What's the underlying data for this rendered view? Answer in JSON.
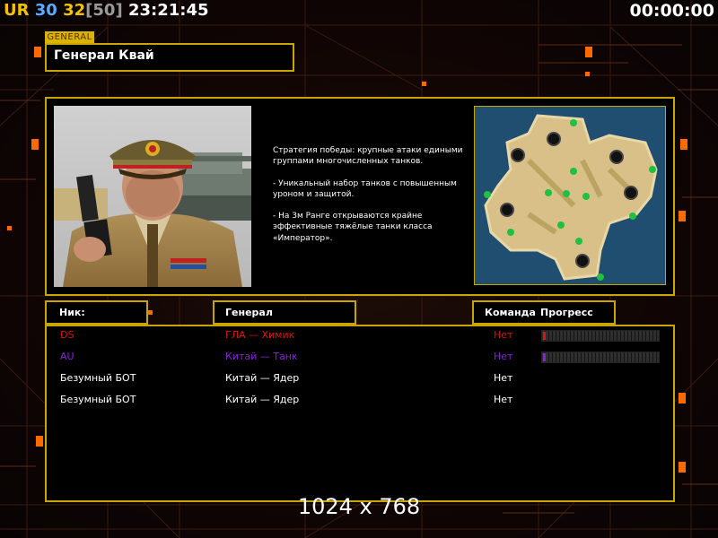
{
  "hud": {
    "rank_ur": "UR",
    "rank_30": "30",
    "rank_32": "32",
    "rank_50": "[50]",
    "clock": "23:21:45",
    "timer": "00:00:00"
  },
  "general": {
    "tab_label": "GENERAL",
    "name": "Генерал Квай",
    "description": "Стратегия победы: крупные атаки едиными\n группами многочисленных танков.\n\n- Уникальный набор танков с повышенным\n уроном и защитой.\n\n- На 3м Ранге открываются крайне\n эффективные тяжёлые танки класса\n «Император»."
  },
  "table": {
    "nick_header": "Ник:",
    "general_header": "Генерал",
    "team_header": "Команда",
    "progress_header": "Прогресс",
    "players": [
      {
        "name": "DS",
        "general": "ГЛА — Химик",
        "team": "Нет",
        "color": "#e01010",
        "has_progress": true,
        "progress": 0.02
      },
      {
        "name": "AU",
        "general": "Китай — Танк",
        "team": "Нет",
        "color": "#8a1fe0",
        "has_progress": true,
        "progress": 0.02
      },
      {
        "name": "Безумный БОТ",
        "general": "Китай — Ядер",
        "team": "Нет",
        "color": "#ffffff",
        "has_progress": false,
        "progress": 0
      },
      {
        "name": "Безумный БОТ",
        "general": "Китай — Ядер",
        "team": "Нет",
        "color": "#ffffff",
        "has_progress": false,
        "progress": 0
      }
    ]
  },
  "resolution_label": "1024 x 768",
  "colors": {
    "accent": "#c9a500",
    "ur": "#f2c200",
    "rank30": "#5aaaff",
    "rank32": "#f2c200",
    "rank50": "#9a9a9a"
  }
}
